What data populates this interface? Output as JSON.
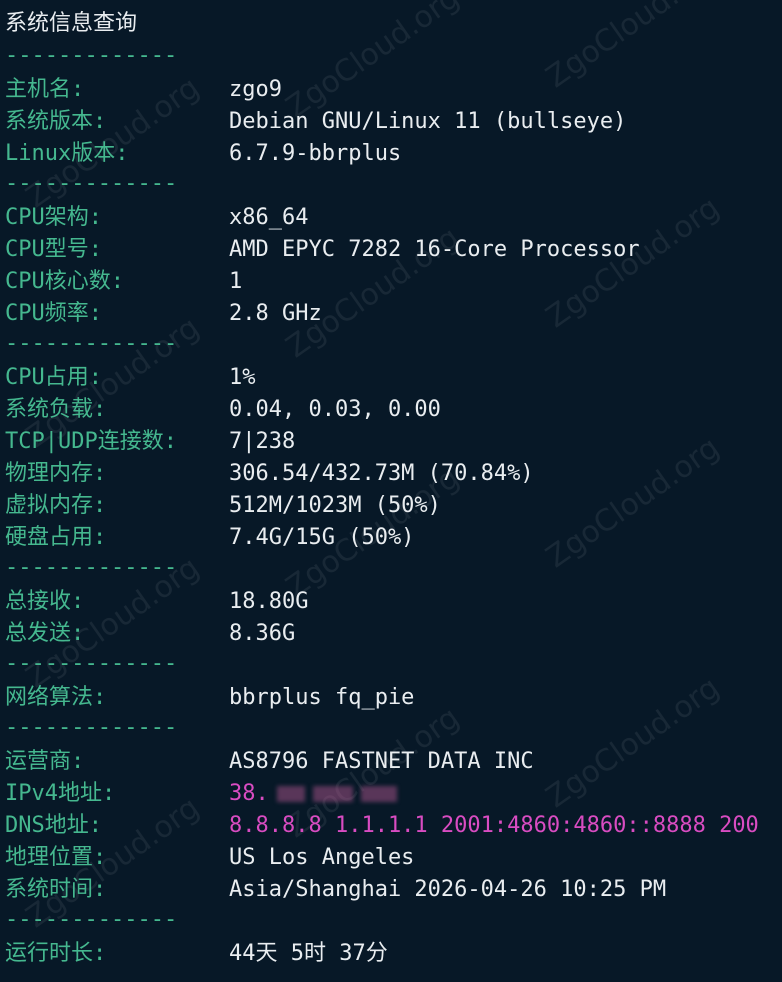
{
  "title": "系统信息查询",
  "separator": "-------------",
  "watermark": "ZgoCloud.org",
  "rows": {
    "hostname": {
      "label": "主机名:",
      "value": "zgo9"
    },
    "os_version": {
      "label": "系统版本:",
      "value": "Debian GNU/Linux 11 (bullseye)"
    },
    "linux_version": {
      "label": "Linux版本:",
      "value": "6.7.9-bbrplus"
    },
    "cpu_arch": {
      "label": "CPU架构:",
      "value": "x86_64"
    },
    "cpu_model": {
      "label": "CPU型号:",
      "value": "AMD EPYC 7282 16-Core Processor"
    },
    "cpu_cores": {
      "label": "CPU核心数:",
      "value": "1"
    },
    "cpu_freq": {
      "label": "CPU频率:",
      "value": "2.8 GHz"
    },
    "cpu_usage": {
      "label": "CPU占用:",
      "value": "1%"
    },
    "sys_load": {
      "label": "系统负载:",
      "value": "0.04, 0.03, 0.00"
    },
    "tcp_udp": {
      "label": "TCP|UDP连接数:",
      "value": "7|238"
    },
    "phys_mem": {
      "label": "物理内存:",
      "value": "306.54/432.73M (70.84%)"
    },
    "virt_mem": {
      "label": "虚拟内存:",
      "value": "512M/1023M (50%)"
    },
    "disk": {
      "label": "硬盘占用:",
      "value": "7.4G/15G (50%)"
    },
    "total_rx": {
      "label": "总接收:",
      "value": "18.80G"
    },
    "total_tx": {
      "label": "总发送:",
      "value": "8.36G"
    },
    "congestion": {
      "label": "网络算法:",
      "value": "bbrplus fq_pie"
    },
    "isp": {
      "label": "运营商:",
      "value": "AS8796 FASTNET DATA INC"
    },
    "ipv4": {
      "label": "IPv4地址:",
      "value": "38."
    },
    "dns": {
      "label": "DNS地址:",
      "value": "8.8.8.8 1.1.1.1 2001:4860:4860::8888 200"
    },
    "location": {
      "label": "地理位置:",
      "value": "US Los Angeles"
    },
    "sys_time": {
      "label": "系统时间:",
      "value": "Asia/Shanghai 2026-04-26 10:25 PM"
    },
    "uptime": {
      "label": "运行时长:",
      "value": "44天 5时 37分"
    }
  },
  "colors": {
    "background": "#071827",
    "label": "#45b88f",
    "value": "#e9edf0",
    "highlight": "#d94cc2"
  }
}
